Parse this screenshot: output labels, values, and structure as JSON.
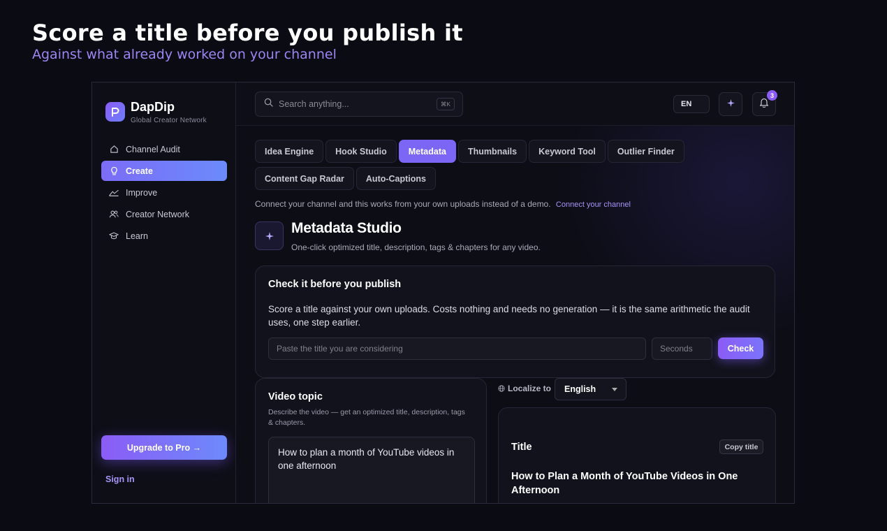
{
  "hero": {
    "title": "Score a title before you publish it",
    "subtitle": "Against what already worked on your channel"
  },
  "brand": {
    "name": "DapDip",
    "tagline": "Global Creator Network",
    "accent": "#8b5cf6"
  },
  "sidebar": {
    "items": [
      {
        "label": "Channel Audit",
        "icon": "home-icon",
        "active": false
      },
      {
        "label": "Create",
        "icon": "lightbulb-icon",
        "active": true
      },
      {
        "label": "Improve",
        "icon": "trend-icon",
        "active": false
      },
      {
        "label": "Creator Network",
        "icon": "users-icon",
        "active": false
      },
      {
        "label": "Learn",
        "icon": "graduation-cap-icon",
        "active": false
      }
    ],
    "upgrade_label": "Upgrade to Pro →",
    "signin_label": "Sign in"
  },
  "topbar": {
    "search_placeholder": "Search anything...",
    "search_shortcut": "⌘K",
    "language": "EN",
    "notification_count": "3"
  },
  "tabs": [
    {
      "label": "Idea Engine",
      "active": false
    },
    {
      "label": "Hook Studio",
      "active": false
    },
    {
      "label": "Metadata",
      "active": true
    },
    {
      "label": "Thumbnails",
      "active": false
    },
    {
      "label": "Keyword Tool",
      "active": false
    },
    {
      "label": "Outlier Finder",
      "active": false
    },
    {
      "label": "Content Gap Radar",
      "active": false
    },
    {
      "label": "Auto-Captions",
      "active": false
    }
  ],
  "connect": {
    "text": "Connect your channel and this works from your own uploads instead of a demo.",
    "link": "Connect your channel"
  },
  "studio": {
    "title": "Metadata Studio",
    "subtitle": "One-click optimized title, description, tags & chapters for any video."
  },
  "check": {
    "title": "Check it before you publish",
    "description": "Score a title against your own uploads. Costs nothing and needs no generation — it is the same arithmetic the audit uses, one step earlier.",
    "title_placeholder": "Paste the title you are considering",
    "seconds_placeholder": "Seconds",
    "button_label": "Check"
  },
  "topic": {
    "title": "Video topic",
    "description": "Describe the video — get an optimized title, description, tags & chapters.",
    "value": "How to plan a month of YouTube videos in one afternoon"
  },
  "localize": {
    "label": "Localize to",
    "selected": "English"
  },
  "result": {
    "title_label": "Title",
    "copy_label": "Copy title",
    "title_value": "How to Plan a Month of YouTube Videos in One Afternoon"
  }
}
